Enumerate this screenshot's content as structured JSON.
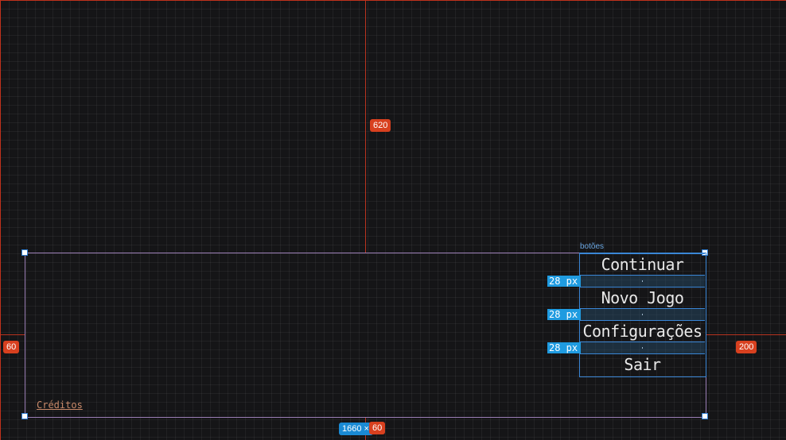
{
  "guides": {
    "top_distance": "620",
    "left_distance": "60",
    "right_distance": "200",
    "bottom_distance": "60"
  },
  "frame": {
    "size_label": "1660 × "
  },
  "menu": {
    "container_label": "botões",
    "buttons": [
      {
        "label": "Continuar"
      },
      {
        "label": "Novo Jogo"
      },
      {
        "label": "Configurações"
      },
      {
        "label": "Sair"
      }
    ],
    "gap_label": "28 px"
  },
  "credits": {
    "label": "Créditos"
  },
  "colors": {
    "background": "#151517",
    "guide": "#b8331f",
    "selection": "#9a7eb5",
    "container_outline": "#3a86d6",
    "badge_red": "#d8401f",
    "badge_blue": "#1a8ad4",
    "credits_text": "#c98a6a"
  }
}
